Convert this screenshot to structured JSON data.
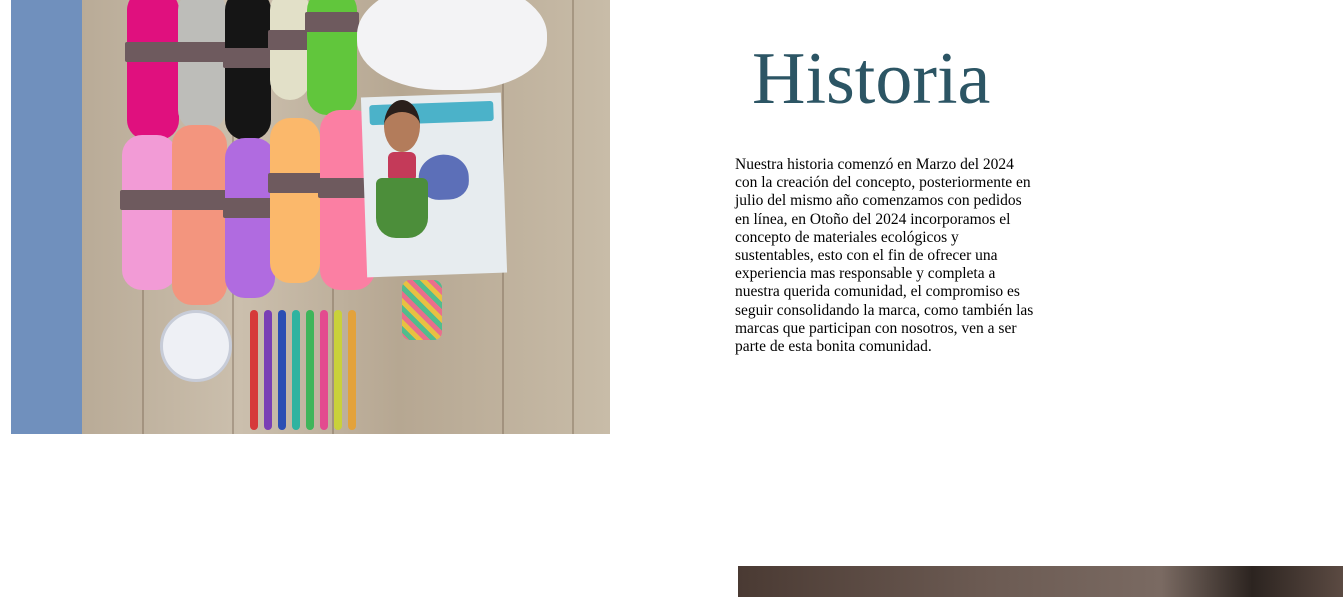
{
  "section": {
    "title": "Historia",
    "body": "Nuestra historia comenzó en Marzo del 2024 con la creación del concepto, posteriormente en julio del mismo año comenzamos con pedidos en línea, en Otoño del 2024 incorporamos el concepto de materiales ecológicos y sustentables, esto con el fin de ofrecer una experiencia mas responsable y completa a nuestra querida comunidad, el compromiso es seguir consolidando la marca, como también las marcas que participan con nosotros, ven a ser parte de esta bonita comunidad."
  },
  "colors": {
    "title": "#2c5564",
    "accent_strip": "#7090bd",
    "background": "#ffffff"
  },
  "images": {
    "hero_photo": "crochet-yarn-kit-photo",
    "bottom_photo": "person-photo"
  }
}
